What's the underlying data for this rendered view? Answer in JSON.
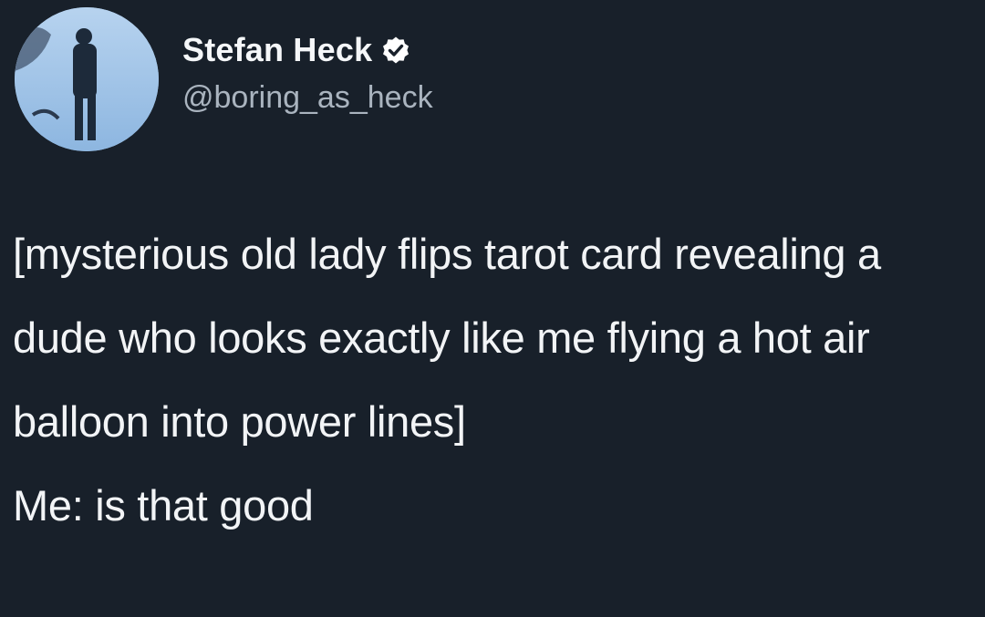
{
  "user": {
    "display_name": "Stefan Heck",
    "handle": "@boring_as_heck",
    "verified": true,
    "verified_icon": "verified-badge-icon"
  },
  "tweet": {
    "line1": "[mysterious old lady flips tarot card revealing a dude who looks exactly like me flying a hot air balloon into power lines]",
    "line2": "Me: is that good"
  },
  "colors": {
    "background": "#18202a",
    "text": "#f2f4f6",
    "handle": "#aab4bf"
  }
}
